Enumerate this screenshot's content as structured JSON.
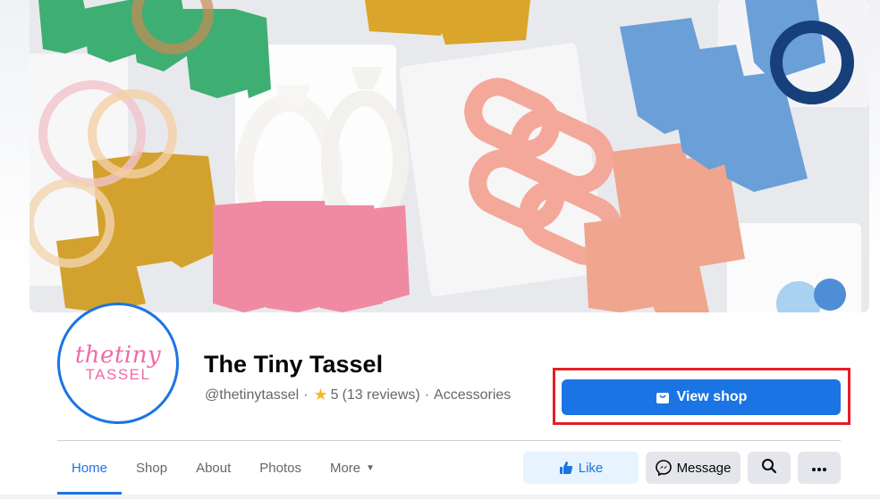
{
  "page": {
    "name": "The Tiny Tassel",
    "handle": "@thetinytassel",
    "separator": "·",
    "rating": "5",
    "reviews": "(13 reviews)",
    "category": "Accessories"
  },
  "avatar": {
    "logo_top": "thetiny",
    "logo_bottom": "TASSEL"
  },
  "cta": {
    "view_shop_label": "View shop"
  },
  "tabs": [
    {
      "label": "Home",
      "active": true
    },
    {
      "label": "Shop"
    },
    {
      "label": "About"
    },
    {
      "label": "Photos"
    },
    {
      "label": "More"
    }
  ],
  "actions": {
    "like_label": "Like",
    "message_label": "Message"
  },
  "colors": {
    "accent": "#1b74e4",
    "highlight_box": "#e41e26",
    "logo_pink": "#f06aa8"
  },
  "icons": [
    "shop-bag-icon",
    "star-icon",
    "caret-down-icon",
    "thumbs-up-icon",
    "messenger-icon",
    "search-icon",
    "more-dots-icon"
  ]
}
